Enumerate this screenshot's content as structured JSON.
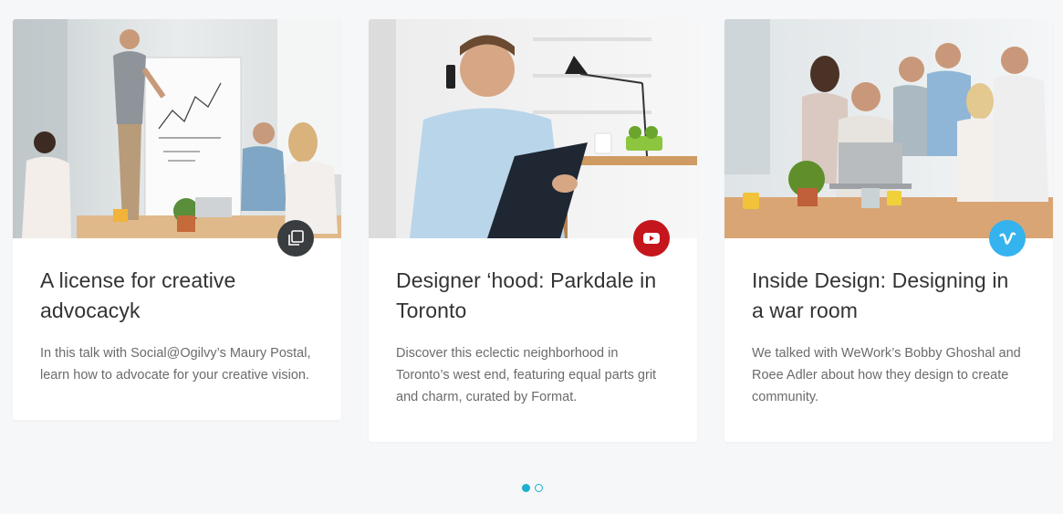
{
  "colors": {
    "background": "#f6f7f9",
    "card": "#ffffff",
    "title": "#333333",
    "description": "#6b6b6b",
    "accent_dot": "#1bb0ce",
    "badge_gallery": "#3a3d40",
    "badge_youtube": "#c4161c",
    "badge_vimeo": "#35b3ee"
  },
  "cards": [
    {
      "title": "A license for creative advocacyk",
      "description": "In this talk with Social@Ogilvy’s Maury Postal, learn how to advocate for your creative vision.",
      "badge_icon": "gallery-icon",
      "image": "team-meeting-whiteboard-photo"
    },
    {
      "title": "Designer ‘hood: Parkdale in Toronto",
      "description": "Discover this eclectic neighborhood in Toronto’s west end, featuring equal parts grit and charm, curated by Format.",
      "badge_icon": "youtube-play-icon",
      "image": "man-on-phone-with-clipboard-photo"
    },
    {
      "title": "Inside Design: Designing in a war room",
      "description": "We talked with WeWork’s Bobby Ghoshal and Roee Adler about how they design to create community.",
      "badge_icon": "vimeo-icon",
      "image": "team-around-laptop-photo"
    }
  ],
  "pagination": {
    "pages": 2,
    "current": 1
  }
}
